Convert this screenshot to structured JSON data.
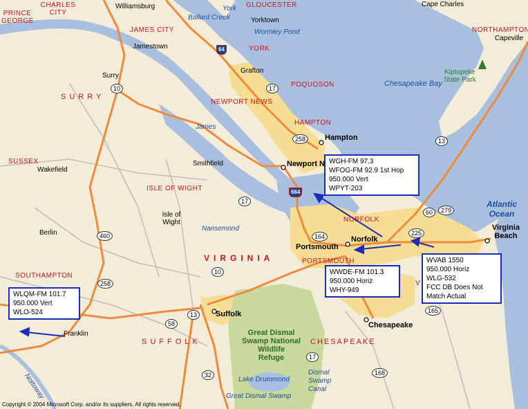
{
  "places": [
    {
      "name": "Williamsburg",
      "kind": "place"
    },
    {
      "name": "Yorktown",
      "kind": "place"
    },
    {
      "name": "Jamestown",
      "kind": "place"
    },
    {
      "name": "Surry",
      "kind": "place"
    },
    {
      "name": "Grafton",
      "kind": "place"
    },
    {
      "name": "Hampton",
      "kind": "city"
    },
    {
      "name": "Newport N",
      "kind": "city"
    },
    {
      "name": "Smithfield",
      "kind": "place"
    },
    {
      "name": "Wakefield",
      "kind": "place"
    },
    {
      "name": "Isle of Wight",
      "kind": "place"
    },
    {
      "name": "Berlin",
      "kind": "place"
    },
    {
      "name": "Portsmouth",
      "kind": "city"
    },
    {
      "name": "Norfolk",
      "kind": "city"
    },
    {
      "name": "Virginia Beach",
      "kind": "city"
    },
    {
      "name": "Suffolk",
      "kind": "city"
    },
    {
      "name": "Chesapeake",
      "kind": "city"
    },
    {
      "name": "Franklin",
      "kind": "place"
    },
    {
      "name": "Cape Charles",
      "kind": "place"
    },
    {
      "name": "Capeville",
      "kind": "place"
    }
  ],
  "counties": [
    "CHARLES CITY",
    "PRINCE GEORGE",
    "GLOUCESTER",
    "JAMES CITY",
    "YORK",
    "POQUOSON",
    "NEWPORT NEWS",
    "HAMPTON",
    "SURRY",
    "SUSSEX",
    "ISLE OF WIGHT",
    "NORFOLK",
    "PORTSMOUTH",
    "SOUTHAMPTON",
    "SUFFOLK",
    "CHESAPEAKE",
    "NORTHAMPTON",
    "V"
  ],
  "state_label": "VIRGINIA",
  "water": [
    "York",
    "Ballard Creek",
    "Wormley Pond",
    "Chesapeake Bay",
    "James",
    "Nansemond",
    "Lake Drummond",
    "Dismal Swamp Canal",
    "Great Dismal Swamp",
    "Nottoway"
  ],
  "ocean": [
    "Atlantic",
    "Ocean"
  ],
  "parks": {
    "kiptopeke": [
      "Kiptopeke",
      "State Park"
    ],
    "refuge": [
      "Great Dismal",
      "Swamp National",
      "Wildlife",
      "Refuge"
    ]
  },
  "routes": {
    "interstates": [
      "64",
      "664"
    ],
    "shields": [
      "17",
      "10",
      "258",
      "13",
      "17",
      "460",
      "10",
      "258",
      "13",
      "58",
      "17",
      "32",
      "164",
      "60",
      "279",
      "225",
      "165",
      "168"
    ]
  },
  "callouts": {
    "wgh": [
      "WGH-FM  97.3",
      "WFOG-FM 92.9 1st Hop",
      "950.000 Vert",
      "WPYT-203"
    ],
    "wwde": [
      "WWDE-FM  101.3",
      "950.000 Horiz",
      "WHY-949"
    ],
    "wvab": [
      "WVAB 1550",
      "950.000 Horiz",
      "WLG-532",
      "FCC DB Does Not",
      "Match Actual"
    ],
    "wlqm": [
      "WLQM-FM  101.7",
      "950.000 Vert",
      "WLO-524"
    ]
  },
  "copyright": "Copyright © 2004 Microsoft Corp. and/or its suppliers. All rights reserved.",
  "colors": {
    "land": "#f3ecd9",
    "water": "#a9bfdf",
    "urban": "#f6dd94",
    "park": "#c9d99c",
    "major_road": "#ef8a3a",
    "minor_road": "#bdbdbd",
    "callout_border": "#1a2db8",
    "arrow": "#1a2db8"
  }
}
